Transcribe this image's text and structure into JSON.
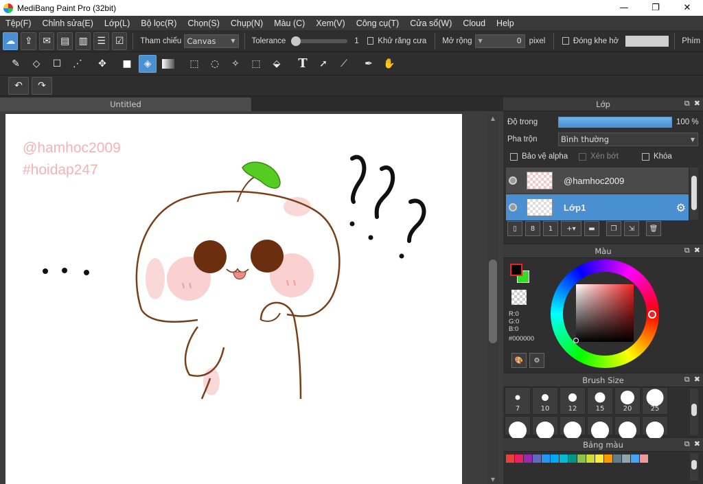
{
  "window": {
    "title": "MediBang Paint Pro (32bit)",
    "minimize": "—",
    "maximize": "❐",
    "close": "✕"
  },
  "menu": [
    "Tệp(F)",
    "Chỉnh sửa(E)",
    "Lớp(L)",
    "Bộ lọc(R)",
    "Chọn(S)",
    "Chụp(N)",
    "Màu (C)",
    "Xem(V)",
    "Công cụ(T)",
    "Cửa sổ(W)",
    "Cloud",
    "Help"
  ],
  "toolbar1": {
    "reference_label": "Tham chiếu",
    "reference_value": "Canvas",
    "tolerance_label": "Tolerance",
    "tolerance_value": "1",
    "antialias_label": "Khử răng cưa",
    "expand_label": "Mở rộng",
    "expand_value": "0",
    "expand_unit": "pixel",
    "close_gap_label": "Đóng khe hở",
    "shortcut_label": "Phím"
  },
  "document": {
    "tab_title": "Untitled"
  },
  "canvas_text": {
    "watermark1": "@hamhoc2009",
    "watermark2": "#hoidap247"
  },
  "layers_panel": {
    "title": "Lớp",
    "opacity_label": "Độ trong",
    "opacity_value": "100 %",
    "blend_label": "Pha trộn",
    "blend_value": "Bình thường",
    "protect_alpha_label": "Bảo vệ alpha",
    "clipping_label": "Xén bớt",
    "lock_label": "Khóa",
    "layers": [
      {
        "name": "@hamhoc2009",
        "selected": false
      },
      {
        "name": "Lớp1",
        "selected": true
      }
    ]
  },
  "color_panel": {
    "title": "Màu",
    "r": "R:0",
    "g": "G:0",
    "b": "B:0",
    "hex": "#000000",
    "primary": "#000000",
    "secondary": "#33dd22"
  },
  "brush_panel": {
    "title": "Brush Size",
    "sizes": [
      "7",
      "10",
      "12",
      "15",
      "20",
      "25"
    ]
  },
  "palette_panel": {
    "title": "Bảng màu",
    "colors": [
      "#e8413c",
      "#e91e63",
      "#9c27b0",
      "#5c6bc0",
      "#2196f3",
      "#03a9f4",
      "#00bcd4",
      "#009688",
      "#8bc34a",
      "#cddc39",
      "#ffeb3b",
      "#ff9800",
      "#607d8b",
      "#90a4ae",
      "#42a5f5",
      "#ef9a9a"
    ]
  }
}
